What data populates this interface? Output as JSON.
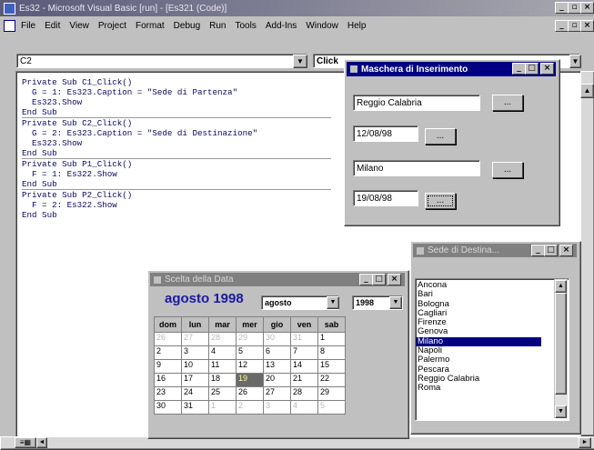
{
  "app": {
    "title": "Es32 - Microsoft Visual Basic [run] - [Es321 (Code)]",
    "window_controls": [
      "_",
      "×"
    ],
    "document_controls": [
      "_",
      "×"
    ]
  },
  "menu": [
    "File",
    "Edit",
    "View",
    "Project",
    "Format",
    "Debug",
    "Run",
    "Tools",
    "Add-Ins",
    "Window",
    "Help"
  ],
  "code_editor": {
    "object_combo": "C2",
    "procedure_combo": "Click",
    "lines": [
      "Private Sub C1_Click()",
      "  G = 1: Es323.Caption = \"Sede di Partenza\"",
      "  Es323.Show",
      "End Sub",
      "Private Sub C2_Click()",
      "  G = 2: Es323.Caption = \"Sede di Destinazione\"",
      "  Es323.Show",
      "End Sub",
      "Private Sub P1_Click()",
      "  F = 1: Es322.Show",
      "End Sub",
      "Private Sub P2_Click()",
      "  F = 2: Es322.Show",
      "End Sub"
    ]
  },
  "maschera": {
    "title": "Maschera di Inserimento",
    "departure_city": "Reggio Calabria",
    "departure_date": "12/08/98",
    "destination_city": "Milano",
    "return_date": "19/08/98",
    "button_label": "..."
  },
  "sede": {
    "title": "Sede di Destina...",
    "items": [
      "Ancona",
      "Bari",
      "Bologna",
      "Cagliari",
      "Firenze",
      "Genova",
      "Milano",
      "Napoli",
      "Palermo",
      "Pescara",
      "Reggio Calabria",
      "Roma"
    ],
    "selected": "Milano"
  },
  "calendar": {
    "title": "Scelta della Data",
    "heading": "agosto 1998",
    "month_select": "agosto",
    "year_select": "1998",
    "weekdays": [
      "dom",
      "lun",
      "mar",
      "mer",
      "gio",
      "ven",
      "sab"
    ],
    "weeks": [
      [
        "26",
        "27",
        "28",
        "29",
        "30",
        "31",
        "1"
      ],
      [
        "2",
        "3",
        "4",
        "5",
        "6",
        "7",
        "8"
      ],
      [
        "9",
        "10",
        "11",
        "12",
        "13",
        "14",
        "15"
      ],
      [
        "16",
        "17",
        "18",
        "19",
        "20",
        "21",
        "22"
      ],
      [
        "23",
        "24",
        "25",
        "26",
        "27",
        "28",
        "29"
      ],
      [
        "30",
        "31",
        "1",
        "2",
        "3",
        "4",
        "5"
      ]
    ],
    "selected_day": "19"
  },
  "colors": {
    "title_active": "#000080",
    "title_inactive": "#808080",
    "calendar_heading": "#1a1aa0",
    "selection": "#000080"
  }
}
